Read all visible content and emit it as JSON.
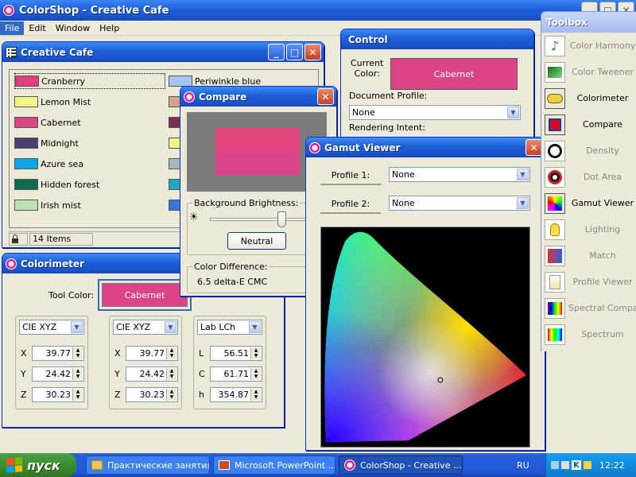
{
  "app": {
    "title": "ColorShop - Creative Cafe",
    "menu": [
      "File",
      "Edit",
      "Window",
      "Help"
    ]
  },
  "cafe": {
    "title": "Creative Cafe",
    "status_count": "14 Items",
    "swatches_col1": [
      {
        "name": "Cranberry",
        "color": "#e0407a"
      },
      {
        "name": "Lemon Mist",
        "color": "#f5f58a"
      },
      {
        "name": "Cabernet",
        "color": "#db4486"
      },
      {
        "name": "Midnight",
        "color": "#4a3e72"
      },
      {
        "name": "Azure sea",
        "color": "#0ea4e8"
      },
      {
        "name": "Hidden forest",
        "color": "#0f6a52"
      },
      {
        "name": "Irish mist",
        "color": "#b9e3b3"
      }
    ],
    "swatches_col2": [
      {
        "name": "Periwinkle blue",
        "color": "#a6c4f4"
      },
      {
        "name": "",
        "color": "#d9a38a"
      },
      {
        "name": "",
        "color": "#7a2e50"
      },
      {
        "name": "",
        "color": "#f4f08a"
      },
      {
        "name": "",
        "color": "#a8b8b8"
      },
      {
        "name": "",
        "color": "#24a8c0"
      },
      {
        "name": "",
        "color": "#3c72d8"
      }
    ]
  },
  "colorimeter": {
    "title": "Colorimeter",
    "tool_color_label": "Tool Color:",
    "tool_color_name": "Cabernet",
    "tool_color": "#db4486",
    "groups": [
      {
        "space": "CIE XYZ",
        "rows": [
          {
            "label": "X",
            "value": "39.77"
          },
          {
            "label": "Y",
            "value": "24.42"
          },
          {
            "label": "Z",
            "value": "30.23"
          }
        ]
      },
      {
        "space": "CIE XYZ",
        "rows": [
          {
            "label": "X",
            "value": "39.77"
          },
          {
            "label": "Y",
            "value": "24.42"
          },
          {
            "label": "Z",
            "value": "30.23"
          }
        ]
      },
      {
        "space": "Lab LCh",
        "rows": [
          {
            "label": "L",
            "value": "56.51"
          },
          {
            "label": "C",
            "value": "61.71"
          },
          {
            "label": "h",
            "value": "354.87"
          }
        ]
      }
    ]
  },
  "compare": {
    "title": "Compare",
    "color_a": "#e3467f",
    "color_b": "#d9448a",
    "bg_label": "Background Brightness:",
    "brightness_level": 0.6,
    "neutral_label": "Neutral",
    "diff_label": "Color Difference:",
    "diff_value": "6.5 delta-E CMC"
  },
  "control": {
    "title": "Control",
    "current_color_label": "Current\nColor:",
    "current_color_name": "Cabernet",
    "current_color": "#db4486",
    "doc_profile_label": "Document Profile:",
    "doc_profile_value": "None",
    "rendering_intent_label": "Rendering Intent:"
  },
  "gamut": {
    "title": "Gamut Viewer",
    "profile1_label": "Profile 1:",
    "profile1_value": "None",
    "profile2_label": "Profile 2:",
    "profile2_value": "None"
  },
  "toolbox": {
    "title": "Toolbox",
    "tools": [
      {
        "label": "Color Harmony",
        "icon": "music-note-icon",
        "active": false
      },
      {
        "label": "Color Tweener",
        "icon": "gradient-icon",
        "active": false
      },
      {
        "label": "Colorimeter",
        "icon": "tape-measure-icon",
        "active": true
      },
      {
        "label": "Compare",
        "icon": "compare-squares-icon",
        "active": true
      },
      {
        "label": "Density",
        "icon": "crosshair-icon",
        "active": false
      },
      {
        "label": "Dot Area",
        "icon": "target-icon",
        "active": false
      },
      {
        "label": "Gamut Viewer",
        "icon": "gamut-icon",
        "active": true
      },
      {
        "label": "Lighting",
        "icon": "bulb-icon",
        "active": false
      },
      {
        "label": "Match",
        "icon": "match-icon",
        "active": false
      },
      {
        "label": "Profile Viewer",
        "icon": "profile-icon",
        "active": false
      },
      {
        "label": "Spectral Compare",
        "icon": "spectral-icon",
        "active": false
      },
      {
        "label": "Spectrum",
        "icon": "spectrum-icon",
        "active": false
      }
    ]
  },
  "taskbar": {
    "start_label": "пуск",
    "tasks": [
      "Практические занятия",
      "Microsoft PowerPoint ...",
      "ColorShop - Creative ..."
    ],
    "lang": "RU",
    "clock": "12:22"
  }
}
